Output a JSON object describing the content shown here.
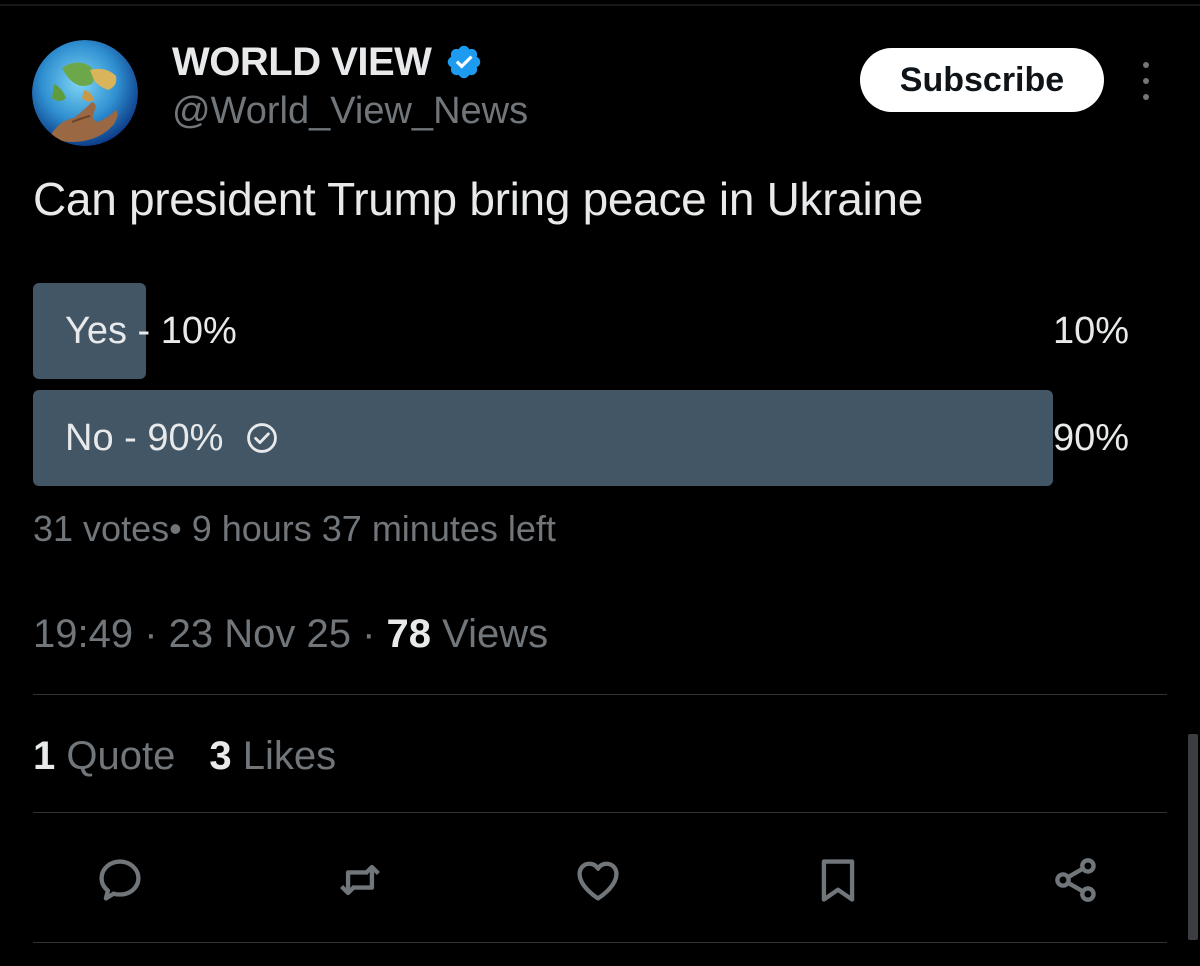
{
  "author": {
    "name": "WORLD VIEW",
    "handle": "@World_View_News",
    "verified": true,
    "avatar": "globe-in-hand-image"
  },
  "header": {
    "subscribe_label": "Subscribe",
    "more_icon": "more-vertical-icon"
  },
  "tweet": {
    "text": "Can president Trump bring peace in Ukraine"
  },
  "poll": {
    "options": [
      {
        "label": "Yes - 10%",
        "percent_label": "10%",
        "fraction": 0.1,
        "selected": false
      },
      {
        "label": "No - 90%",
        "percent_label": "90%",
        "fraction": 0.9,
        "selected": true
      }
    ],
    "meta": "31 votes• 9 hours 37 minutes left",
    "fill_color": "#435666"
  },
  "timestamp": {
    "time_date": "19:49 · 23 Nov 25 · ",
    "views_count": "78",
    "views_label": " Views"
  },
  "stats": {
    "quotes_count": "1",
    "quotes_label": "Quote",
    "likes_count": "3",
    "likes_label": "Likes"
  },
  "actions": [
    {
      "name": "reply-icon"
    },
    {
      "name": "retweet-icon"
    },
    {
      "name": "like-icon"
    },
    {
      "name": "bookmark-icon"
    },
    {
      "name": "share-icon"
    }
  ],
  "colors": {
    "background": "#000000",
    "text_primary": "#e7e9ea",
    "text_secondary": "#71767b",
    "verified": "#1d9bf0",
    "poll_fill": "#435666"
  }
}
